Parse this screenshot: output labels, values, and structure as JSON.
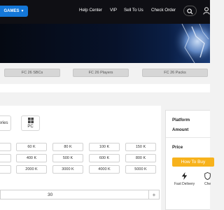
{
  "header": {
    "games_label": "GAMES",
    "nav": [
      "Help Center",
      "VIP",
      "Sell To Us",
      "Check Order"
    ]
  },
  "subtabs": [
    "FC 26 SBCs",
    "FC 26 Players",
    "FC 26 Packs"
  ],
  "platforms": [
    {
      "label": "eries",
      "icon": "none"
    },
    {
      "label": "PC",
      "icon": "windows-icon"
    }
  ],
  "amounts": [
    [
      "",
      "60 K",
      "80 K",
      "100 K",
      "150 K"
    ],
    [
      "",
      "400 K",
      "500 K",
      "600 K",
      "800 K"
    ],
    [
      "",
      "2000 K",
      "3000 K",
      "4000 K",
      "5000 K"
    ]
  ],
  "custom_amount": "30",
  "summary": {
    "platform_label": "Platform",
    "amount_label": "Amount",
    "price_label": "Price",
    "buy_label": "How To Buy",
    "features": [
      {
        "label": "Fast Delivery",
        "icon": "lightning-icon"
      },
      {
        "label": "Che",
        "icon": "shield-icon"
      }
    ]
  },
  "colors": {
    "accent_blue": "#1477d8",
    "buy_button": "#f7b21c",
    "topbar": "#0f0f14"
  }
}
